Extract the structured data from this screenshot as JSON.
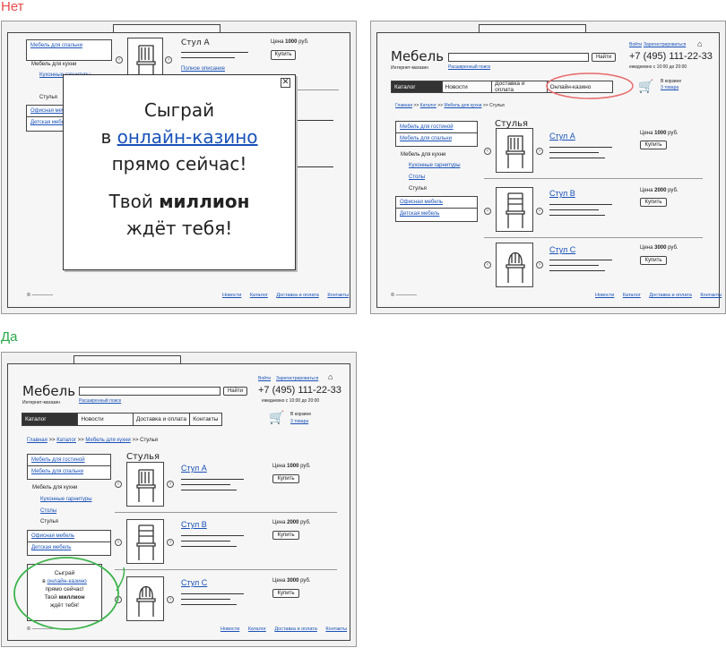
{
  "labels": {
    "bad": "Нет",
    "good": "Да"
  },
  "site": {
    "logo": "Мебель",
    "tagline": "Интернет-магазин",
    "search_button": "Найти",
    "advanced_search": "Расширенный поиск",
    "login": "Войти",
    "register": "Зарегистрироваться",
    "phone": "+7 (495) 111-22-33",
    "hours": "ежедневно с 10:00 до 20:00",
    "cart_label": "В корзине",
    "cart_count": "3 товара"
  },
  "nav": [
    "Каталог",
    "Новости",
    "Доставка и оплата",
    "Контакты"
  ],
  "nav_bad": [
    "Каталог",
    "Новости",
    "Доставка и оплата",
    "Онлайн-казино"
  ],
  "breadcrumb": {
    "home": "Главная",
    "catalog": "Каталог",
    "kitchen": "Мебель для кухни",
    "current": "Стулья"
  },
  "sep": ">>",
  "menu": {
    "living": "Мебель для гостиной",
    "bedroom": "Мебель для спальни",
    "kitchen": "Мебель для кухни",
    "kitchen_sets": "Кухонные гарнитуры",
    "tables": "Столы",
    "chairs": "Стулья",
    "office": "Офисная мебель",
    "kids": "Детская мебель"
  },
  "section_title": "Стулья",
  "products": [
    {
      "name": "Стул А",
      "price_prefix": "Цена",
      "price": "1000",
      "price_suffix": "руб.",
      "buy": "Купить"
    },
    {
      "name": "Стул В",
      "price_prefix": "Цена",
      "price": "2000",
      "price_suffix": "руб.",
      "buy": "Купить"
    },
    {
      "name": "Стул С",
      "price_prefix": "Цена",
      "price": "3000",
      "price_suffix": "руб.",
      "buy": "Купить"
    }
  ],
  "full_description": "Полное описание",
  "footer": [
    "Новости",
    "Каталог",
    "Доставка и оплата",
    "Контакты"
  ],
  "popup": {
    "line1": "Сыграй",
    "line2_pre": "в",
    "line2_link": "онлайн-казино",
    "line3": "прямо сейчас!",
    "line4_pre": "Твой",
    "line4_bold": "миллион",
    "line5": "ждёт тебя!",
    "close": "✕"
  },
  "colors": {
    "bad_label": "#e84c4c",
    "good_label": "#28a848",
    "link": "#1a52b8",
    "circle_bad": "#e86a6a",
    "circle_good": "#3cb44b"
  }
}
